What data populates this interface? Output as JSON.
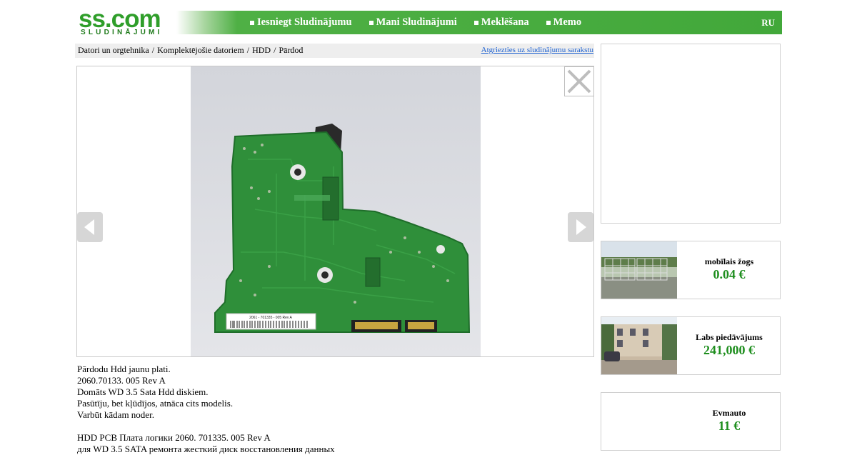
{
  "header": {
    "logo_text": "ss.com",
    "logo_sub": "SLUDINĀJUMI",
    "nav": [
      "Iesniegt Sludinājumu",
      "Mani Sludinājumi",
      "Meklēšana",
      "Memo"
    ],
    "lang": "RU"
  },
  "breadcrumb": {
    "items": [
      "Datori un orgtehnika",
      "Komplektējošie datoriem",
      "HDD",
      "Pārdod"
    ],
    "separator": "/",
    "back_link": "Atgriezties uz sludinājumu sarakstu"
  },
  "gallery": {
    "photo_icon": "hdd-pcb-photo",
    "close_icon": "close-icon",
    "prev_icon": "chevron-left-icon",
    "next_icon": "chevron-right-icon",
    "label_text": "2061 - 701335 - 005 Rev A"
  },
  "description": "Pārdodu Hdd jaunu plati.\n2060.70133. 005 Rev A\nDomāts WD 3.5 Sata Hdd diskiem.\nPasūtīju, bet kļūdījos, atnāca cits modelis.\nVarbūt kādam noder.\n\nHDD PCB Плата логики 2060. 701335. 005 Rev A\nдля WD 3.5 SATA ремонта жесткий диск восстановления данных",
  "sidebar": {
    "cards": [
      {
        "title": "mobīlais žogs",
        "price": "0.04 €",
        "thumb": "fence-photo"
      },
      {
        "title": "Labs piedāvājums",
        "price": "241,000 €",
        "thumb": "building-photo"
      },
      {
        "title": "Evmauto",
        "price": "11 €",
        "thumb": ""
      }
    ]
  },
  "colors": {
    "brand_green": "#42a83a",
    "price_green": "#1e8e1e",
    "link_blue": "#1a5fd0",
    "pcb_green": "#2f8f3a"
  }
}
